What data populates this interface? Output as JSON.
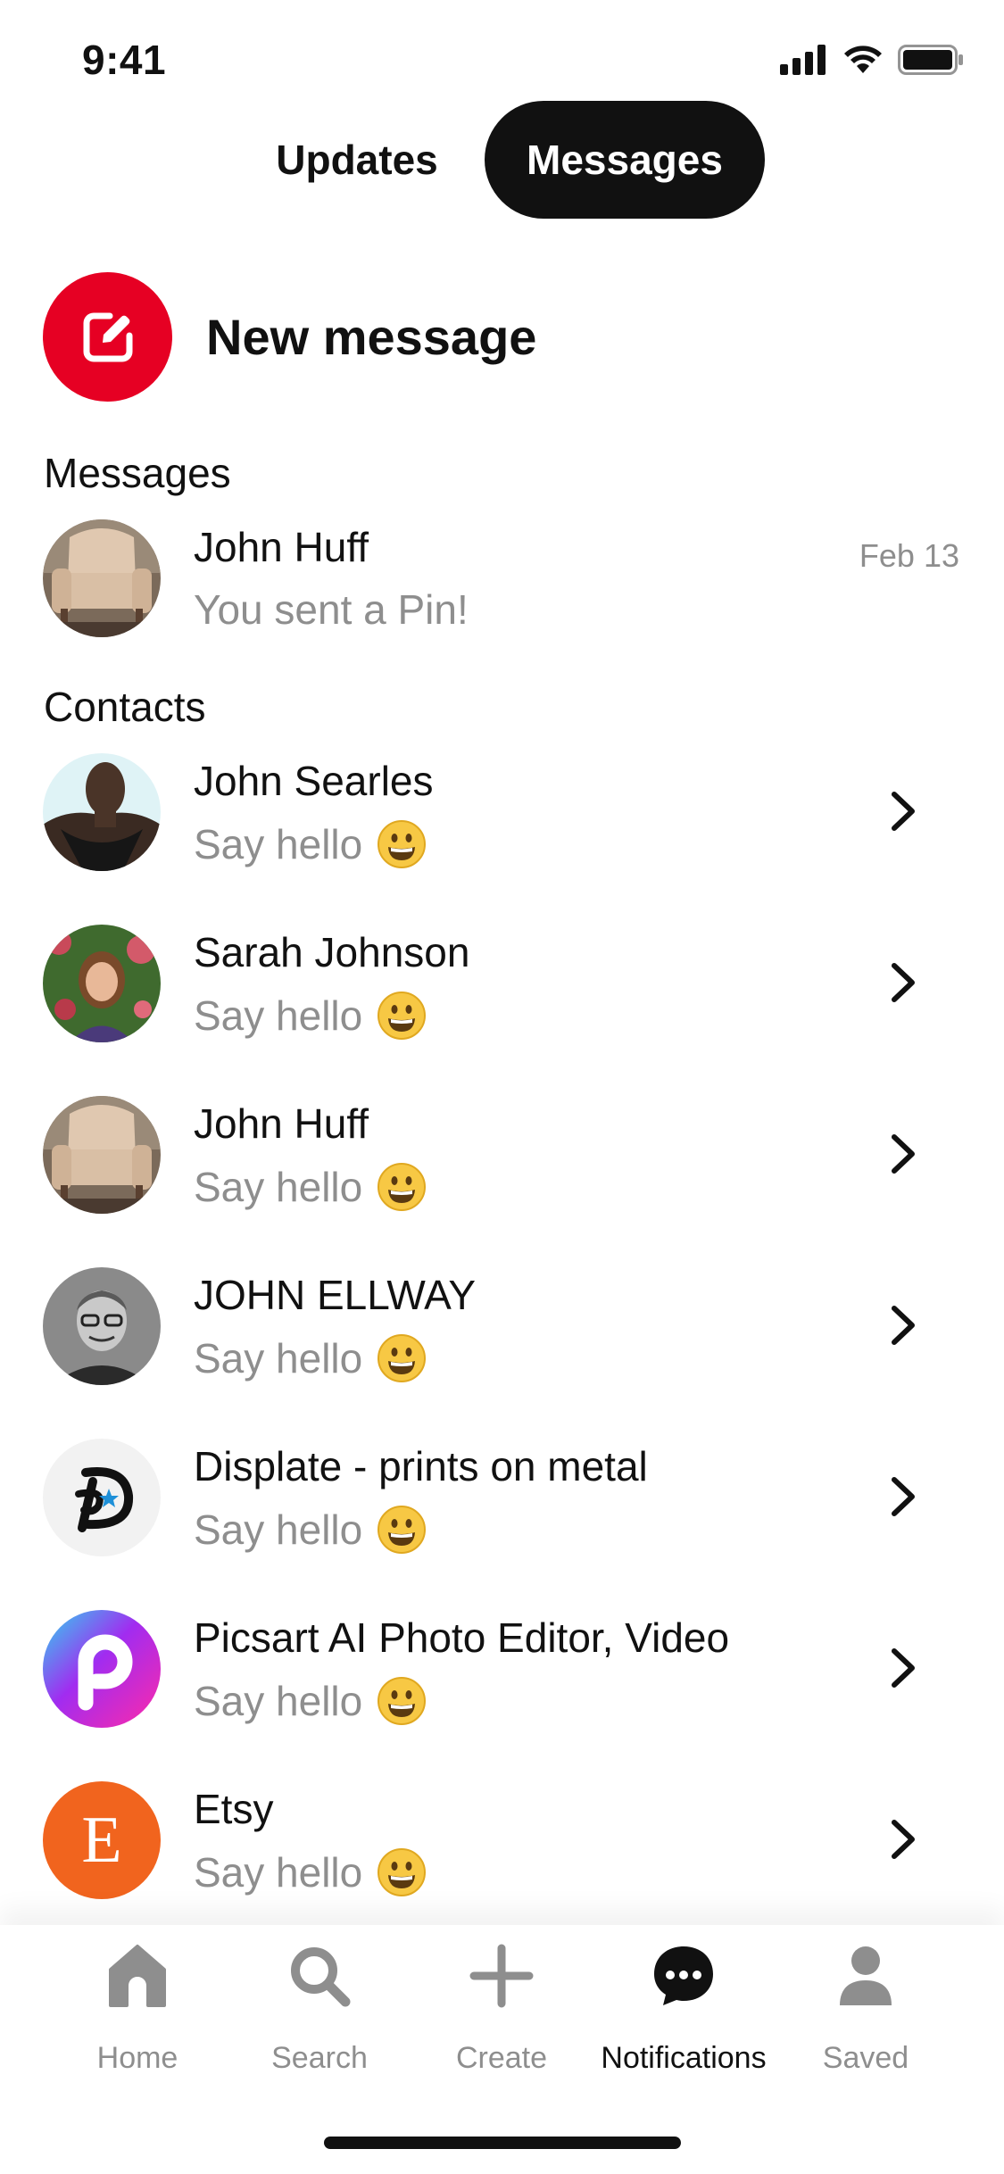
{
  "status_bar": {
    "time": "9:41"
  },
  "tabs": [
    {
      "label": "Updates",
      "active": false
    },
    {
      "label": "Messages",
      "active": true
    }
  ],
  "new_message": {
    "label": "New message",
    "color": "#e60023"
  },
  "messages_section": {
    "title": "Messages",
    "items": [
      {
        "name": "John Huff",
        "preview": "You sent a Pin!",
        "date": "Feb 13",
        "avatar": "armchair-photo"
      }
    ]
  },
  "contacts_section": {
    "title": "Contacts",
    "items": [
      {
        "name": "John Searles",
        "sub": "Say hello",
        "avatar": "person-photo"
      },
      {
        "name": "Sarah Johnson",
        "sub": "Say hello",
        "avatar": "person-garden-photo"
      },
      {
        "name": "John Huff",
        "sub": "Say hello",
        "avatar": "armchair-photo"
      },
      {
        "name": "JOHN ELLWAY",
        "sub": "Say hello",
        "avatar": "person-bw-photo"
      },
      {
        "name": "Displate - prints on metal",
        "sub": "Say hello",
        "avatar": "displate-logo"
      },
      {
        "name": "Picsart AI Photo Editor, Video",
        "sub": "Say hello",
        "avatar": "picsart-logo"
      },
      {
        "name": "Etsy",
        "sub": "Say hello",
        "avatar": "etsy-logo",
        "avatar_letter": "E"
      }
    ]
  },
  "bottom_nav": [
    {
      "label": "Home",
      "icon": "home-icon",
      "active": false
    },
    {
      "label": "Search",
      "icon": "search-icon",
      "active": false
    },
    {
      "label": "Create",
      "icon": "plus-icon",
      "active": false
    },
    {
      "label": "Notifications",
      "icon": "chat-bubble-icon",
      "active": true
    },
    {
      "label": "Saved",
      "icon": "profile-icon",
      "active": false
    }
  ]
}
